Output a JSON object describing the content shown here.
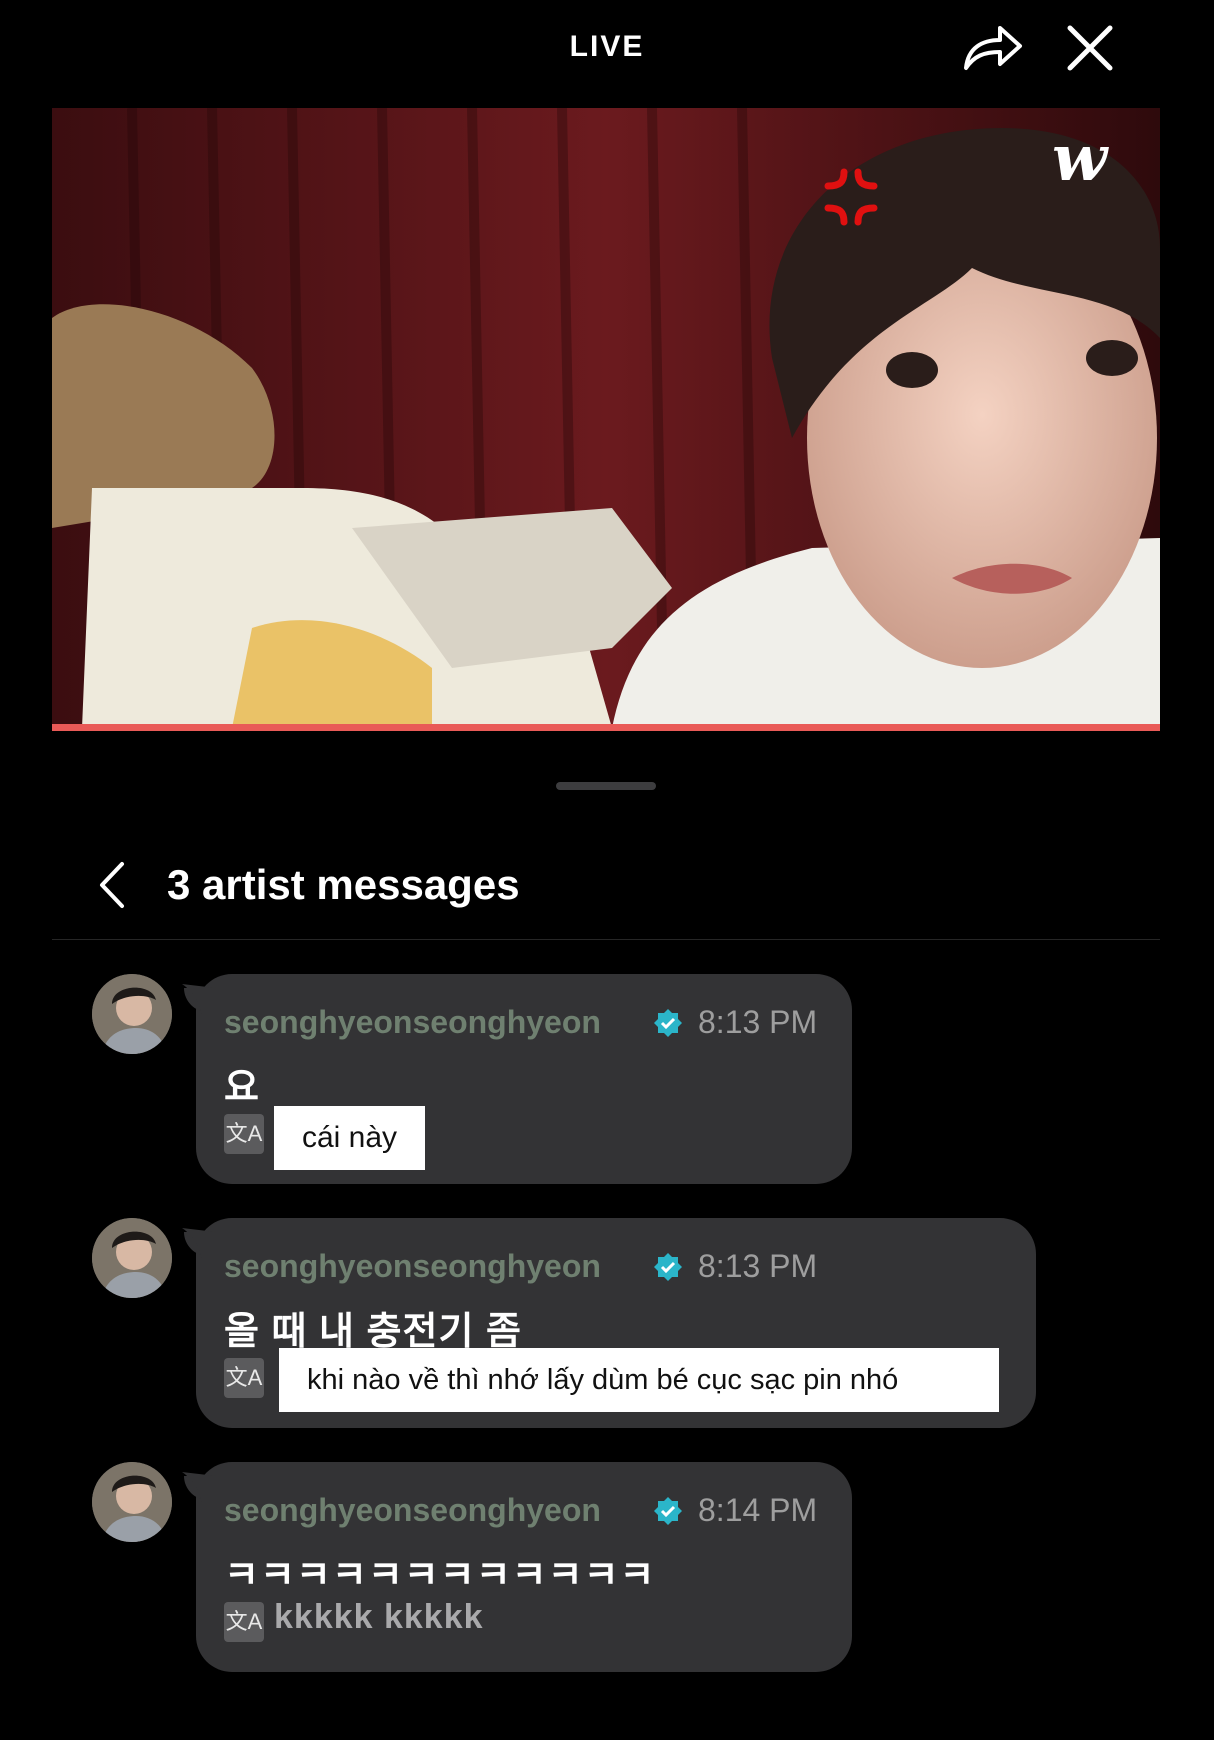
{
  "header": {
    "title": "LIVE",
    "share_icon": "share-arrow-icon",
    "close_icon": "close-x-icon"
  },
  "video": {
    "watermark_icon": "weverse-logo-icon",
    "sticker_icon": "anger-vein-icon",
    "progress_color": "#e95a57"
  },
  "panel": {
    "back_icon": "chevron-left-icon",
    "title": "3 artist messages"
  },
  "messages": [
    {
      "username": "seonghyeonseonghyeon",
      "time": "8:13 PM",
      "text": "요",
      "translation": "cái này",
      "translation_style": "boxed"
    },
    {
      "username": "seonghyeonseonghyeon",
      "time": "8:13 PM",
      "text": "올 때 내 충전기 좀",
      "translation": "khi nào về thì nhớ lấy dùm bé cục sạc pin nhó",
      "translation_style": "boxed"
    },
    {
      "username": "seonghyeonseonghyeon",
      "time": "8:14 PM",
      "text": "ㅋㅋㅋㅋㅋㅋㅋㅋㅋㅋㅋㅋ",
      "translation": "kkkkk kkkkk",
      "translation_style": "plain"
    }
  ],
  "colors": {
    "background": "#000000",
    "bubble": "#333335",
    "username": "#6f8070",
    "verified_badge": "#2bb5c9",
    "time": "#9e9e9e"
  }
}
